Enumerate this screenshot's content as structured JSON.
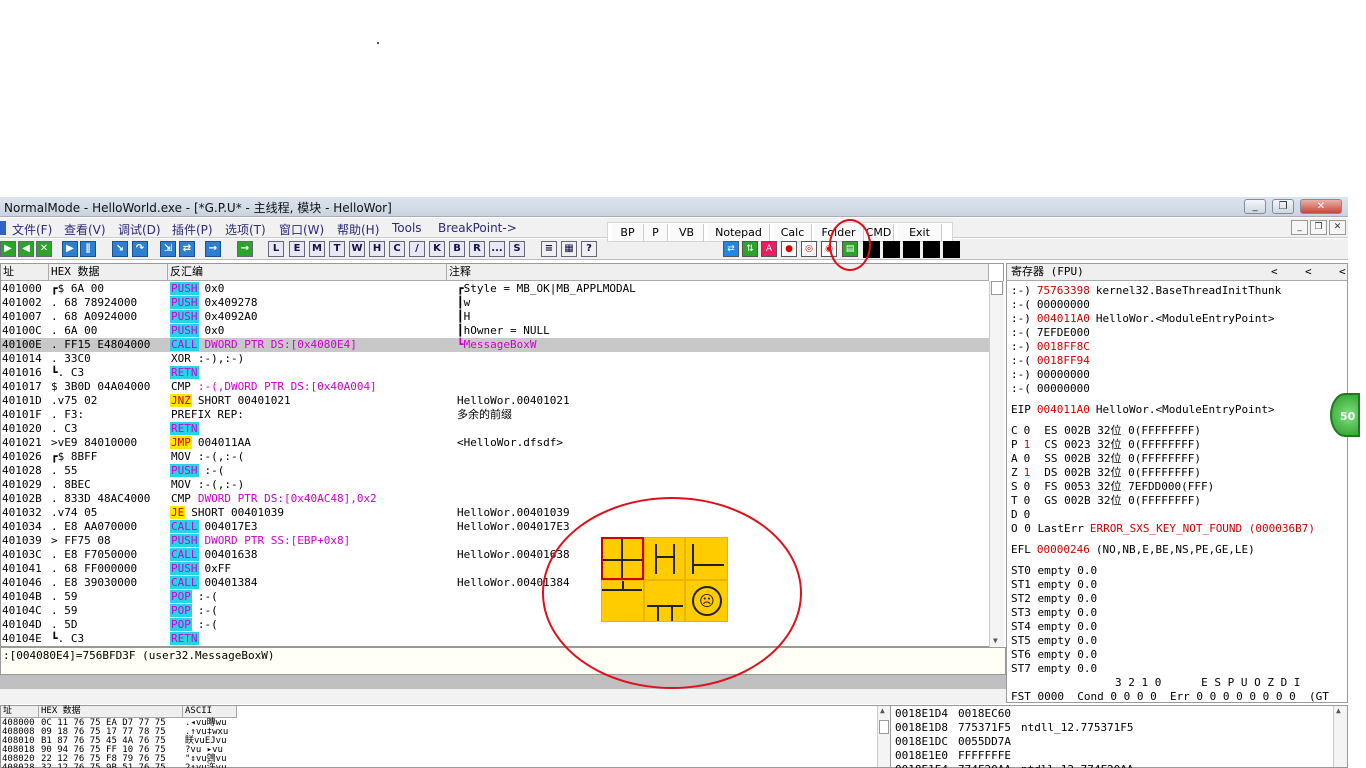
{
  "window": {
    "title": "NormalMode - HelloWorld.exe - [*G.P.U* -  主线程, 模块 - HelloWor]",
    "minimize_label": "_",
    "restore_label": "❐",
    "close_label": "✕",
    "mdi_min": "_",
    "mdi_restore": "❐",
    "mdi_close": "✕"
  },
  "menu": {
    "items": [
      "文件(F)",
      "查看(V)",
      "调试(D)",
      "插件(P)",
      "选项(T)",
      "窗口(W)",
      "帮助(H)",
      "Tools",
      "BreakPoint->"
    ]
  },
  "plugin_toolbar": {
    "buttons": [
      "BP",
      "P",
      "VB",
      "Notepad",
      "Calc",
      "Folder",
      "CMD",
      "Exit"
    ]
  },
  "toolbar": {
    "letter_buttons": [
      "L",
      "E",
      "M",
      "T",
      "W",
      "H",
      "C",
      "/",
      "K",
      "B",
      "R",
      "...",
      "S"
    ],
    "color_buttons": [
      "A"
    ]
  },
  "cpu": {
    "headers": {
      "addr": "址",
      "hex": "HEX 数据",
      "disasm": "反汇编",
      "comment": "注释"
    },
    "rows": [
      {
        "addr": "401000",
        "hex": "┏$ 6A 00",
        "op": "PUSH",
        "cls": "push",
        "arg": "0x0",
        "argc": "arg",
        "cmt": "┏Style = MB_OK|MB_APPLMODAL",
        "cc": ""
      },
      {
        "addr": "401002",
        "hex": ". 68 78924000",
        "op": "PUSH",
        "cls": "push",
        "arg": "0x409278",
        "argc": "arg",
        "cmt": "┃w",
        "cc": ""
      },
      {
        "addr": "401007",
        "hex": ". 68 A0924000",
        "op": "PUSH",
        "cls": "push",
        "arg": "0x4092A0",
        "argc": "arg",
        "cmt": "┃H",
        "cc": ""
      },
      {
        "addr": "40100C",
        "hex": ". 6A 00",
        "op": "PUSH",
        "cls": "push",
        "arg": "0x0",
        "argc": "arg",
        "cmt": "┃hOwner = NULL",
        "cc": ""
      },
      {
        "addr": "40100E",
        "hex": ". FF15 E4804000",
        "op": "CALL",
        "cls": "call",
        "arg": "DWORD PTR DS:[0x4080E4]",
        "argc": "arg-m",
        "cmt": "┗MessageBoxW",
        "cc": "cmt-r"
      },
      {
        "addr": "401014",
        "hex": ". 33C0",
        "op": "XOR",
        "cls": "plain",
        "arg": ":-),:-)",
        "argc": "arg",
        "cmt": "",
        "cc": ""
      },
      {
        "addr": "401016",
        "hex": "┗. C3",
        "op": "RETN",
        "cls": "retn",
        "arg": "",
        "argc": "arg",
        "cmt": "",
        "cc": ""
      },
      {
        "addr": "401017",
        "hex": " $ 3B0D 04A04000",
        "op": "CMP",
        "cls": "plain",
        "arg": ":-(,DWORD PTR DS:[0x40A004]",
        "argc": "arg-m",
        "cmt": "",
        "cc": ""
      },
      {
        "addr": "40101D",
        "hex": " .v75 02",
        "op": "JNZ",
        "cls": "jcc",
        "arg": "SHORT 00401021",
        "argc": "arg",
        "cmt": "HelloWor.00401021",
        "cc": ""
      },
      {
        "addr": "40101F",
        "hex": " . F3:",
        "op": "PREFIX REP:",
        "cls": "plain",
        "arg": "",
        "argc": "arg",
        "cmt": "多余的前缀",
        "cc": ""
      },
      {
        "addr": "401020",
        "hex": " . C3",
        "op": "RETN",
        "cls": "retn",
        "arg": "",
        "argc": "arg",
        "cmt": "",
        "cc": ""
      },
      {
        "addr": "401021",
        "hex": ">vE9 84010000",
        "op": "JMP",
        "cls": "jmp",
        "arg": "004011AA",
        "argc": "arg",
        "cmt": "<HelloWor.dfsdf>",
        "cc": ""
      },
      {
        "addr": "401026",
        "hex": "┏$ 8BFF",
        "op": "MOV",
        "cls": "plain",
        "arg": ":-(,:-(",
        "argc": "arg",
        "cmt": "",
        "cc": ""
      },
      {
        "addr": "401028",
        "hex": ". 55",
        "op": "PUSH",
        "cls": "push",
        "arg": ":-(",
        "argc": "arg",
        "cmt": "",
        "cc": ""
      },
      {
        "addr": "401029",
        "hex": ". 8BEC",
        "op": "MOV",
        "cls": "plain",
        "arg": ":-(,:-)",
        "argc": "arg",
        "cmt": "",
        "cc": ""
      },
      {
        "addr": "40102B",
        "hex": ". 833D 48AC4000",
        "op": "CMP",
        "cls": "plain",
        "arg": "DWORD PTR DS:[0x40AC48],0x2",
        "argc": "arg-m",
        "cmt": "",
        "cc": ""
      },
      {
        "addr": "401032",
        "hex": ".v74 05",
        "op": "JE",
        "cls": "jcc",
        "arg": "SHORT 00401039",
        "argc": "arg",
        "cmt": "HelloWor.00401039",
        "cc": ""
      },
      {
        "addr": "401034",
        "hex": ". E8 AA070000",
        "op": "CALL",
        "cls": "call",
        "arg": "004017E3",
        "argc": "arg",
        "cmt": "HelloWor.004017E3",
        "cc": ""
      },
      {
        "addr": "401039",
        "hex": "> FF75 08",
        "op": "PUSH",
        "cls": "push",
        "arg": "DWORD PTR SS:[EBP+0x8]",
        "argc": "arg-m",
        "cmt": "",
        "cc": ""
      },
      {
        "addr": "40103C",
        "hex": ". E8 F7050000",
        "op": "CALL",
        "cls": "call",
        "arg": "00401638",
        "argc": "arg",
        "cmt": "HelloWor.00401638",
        "cc": ""
      },
      {
        "addr": "401041",
        "hex": ". 68 FF000000",
        "op": "PUSH",
        "cls": "push",
        "arg": "0xFF",
        "argc": "arg",
        "cmt": "",
        "cc": ""
      },
      {
        "addr": "401046",
        "hex": ". E8 39030000",
        "op": "CALL",
        "cls": "call",
        "arg": "00401384",
        "argc": "arg",
        "cmt": "HelloWor.00401384",
        "cc": ""
      },
      {
        "addr": "40104B",
        "hex": ". 59",
        "op": "POP",
        "cls": "pop",
        "arg": ":-(",
        "argc": "arg",
        "cmt": "",
        "cc": ""
      },
      {
        "addr": "40104C",
        "hex": ". 59",
        "op": "POP",
        "cls": "pop",
        "arg": ":-(",
        "argc": "arg",
        "cmt": "",
        "cc": ""
      },
      {
        "addr": "40104D",
        "hex": ". 5D",
        "op": "POP",
        "cls": "pop",
        "arg": ":-(",
        "argc": "arg",
        "cmt": "",
        "cc": ""
      },
      {
        "addr": "40104E",
        "hex": "┗. C3",
        "op": "RETN",
        "cls": "retn",
        "arg": "",
        "argc": "arg",
        "cmt": "",
        "cc": ""
      }
    ],
    "selected_index": 4
  },
  "info": {
    "text": ":[004080E4]=756BFD3F (user32.MessageBoxW)"
  },
  "registers": {
    "header": "寄存器 (FPU)",
    "nav": [
      "<",
      "<",
      "<"
    ],
    "lines": [
      {
        "name": ":-)",
        "val": "75763398",
        "red": true,
        "desc": "kernel32.BaseThreadInitThunk"
      },
      {
        "name": ":-(",
        "val": "00000000",
        "red": false,
        "desc": ""
      },
      {
        "name": ":-)",
        "val": "004011A0",
        "red": true,
        "desc": "HelloWor.<ModuleEntryPoint>"
      },
      {
        "name": ":-(",
        "val": "7EFDE000",
        "red": false,
        "desc": ""
      },
      {
        "name": ":-)",
        "val": "0018FF8C",
        "red": true,
        "desc": ""
      },
      {
        "name": ":-(",
        "val": "0018FF94",
        "red": true,
        "desc": ""
      },
      {
        "name": ":-)",
        "val": "00000000",
        "red": false,
        "desc": ""
      },
      {
        "name": ":-(",
        "val": "00000000",
        "red": false,
        "desc": ""
      }
    ],
    "eip": {
      "name": "EIP",
      "val": "004011A0",
      "desc": "HelloWor.<ModuleEntryPoint>"
    },
    "flags": [
      {
        "f": "C",
        "v": "0",
        "red": false,
        "seg": "ES 002B 32位 0(FFFFFFFF)"
      },
      {
        "f": "P",
        "v": "1",
        "red": true,
        "seg": "CS 0023 32位 0(FFFFFFFF)"
      },
      {
        "f": "A",
        "v": "0",
        "red": false,
        "seg": "SS 002B 32位 0(FFFFFFFF)"
      },
      {
        "f": "Z",
        "v": "1",
        "red": true,
        "seg": "DS 002B 32位 0(FFFFFFFF)"
      },
      {
        "f": "S",
        "v": "0",
        "red": false,
        "seg": "FS 0053 32位 7EFDD000(FFF)"
      },
      {
        "f": "T",
        "v": "0",
        "red": false,
        "seg": "GS 002B 32位 0(FFFFFFFF)"
      },
      {
        "f": "D",
        "v": "0",
        "red": false,
        "seg": ""
      }
    ],
    "lasterr": {
      "label": "O 0  LastErr",
      "val": "ERROR_SXS_KEY_NOT_FOUND (000036B7)"
    },
    "efl": {
      "label": "EFL",
      "val": "00000246",
      "desc": "(NO,NB,E,BE,NS,PE,GE,LE)"
    },
    "fpu": [
      "ST0 empty 0.0",
      "ST1 empty 0.0",
      "ST2 empty 0.0",
      "ST3 empty 0.0",
      "ST4 empty 0.0",
      "ST5 empty 0.0",
      "ST6 empty 0.0",
      "ST7 empty 0.0"
    ],
    "fpu_bits_header": "3 2 1 0      E S P U O Z D I",
    "fst": "FST 0000  Cond 0 0 0 0  Err 0 0 0 0 0 0 0 0  (GT"
  },
  "dump": {
    "headers": {
      "addr": "址",
      "hex": "HEX 数据",
      "ascii": "ASCII"
    },
    "rows": [
      {
        "addr": "408000",
        "hex": "0C 11 76 75 EA D7 77 75",
        "ascii": ".◂vu暷wu"
      },
      {
        "addr": "408008",
        "hex": "09 18 76 75 17 77 78 75",
        "ascii": ".↑vu‡wxu"
      },
      {
        "addr": "408010",
        "hex": "B1 87 76 75 45 4A 76 75",
        "ascii": "眹vuEJvu"
      },
      {
        "addr": "408018",
        "hex": "90 94 76 75 FF 10 76 75",
        "ascii": "?vu ▸vu"
      },
      {
        "addr": "408020",
        "hex": "22 12 76 75 F8 79 76 75",
        "ascii": "\"↕vu鵼vu"
      },
      {
        "addr": "408028",
        "hex": "32 12 76 75 9B 51 76 75",
        "ascii": "2↕vu汻vu"
      }
    ]
  },
  "stack": {
    "rows": [
      {
        "addr": "0018E1D4",
        "val": "0018EC60",
        "desc": ""
      },
      {
        "addr": "0018E1D8",
        "val": "775371F5",
        "desc": "ntdll_12.775371F5"
      },
      {
        "addr": "0018E1DC",
        "val": "0055DD7A",
        "desc": ""
      },
      {
        "addr": "0018E1E0",
        "val": "FFFFFFFE",
        "desc": ""
      },
      {
        "addr": "0018E1E4",
        "val": "774F20AA",
        "desc": "ntdll_12.774F20AA"
      }
    ]
  },
  "badge": {
    "text": "50"
  },
  "colors": {
    "accent_red": "#e0101a",
    "cyan_op": "#26d4e8",
    "yellow_op": "#ffe800",
    "tile_yellow": "#ffcc00"
  }
}
